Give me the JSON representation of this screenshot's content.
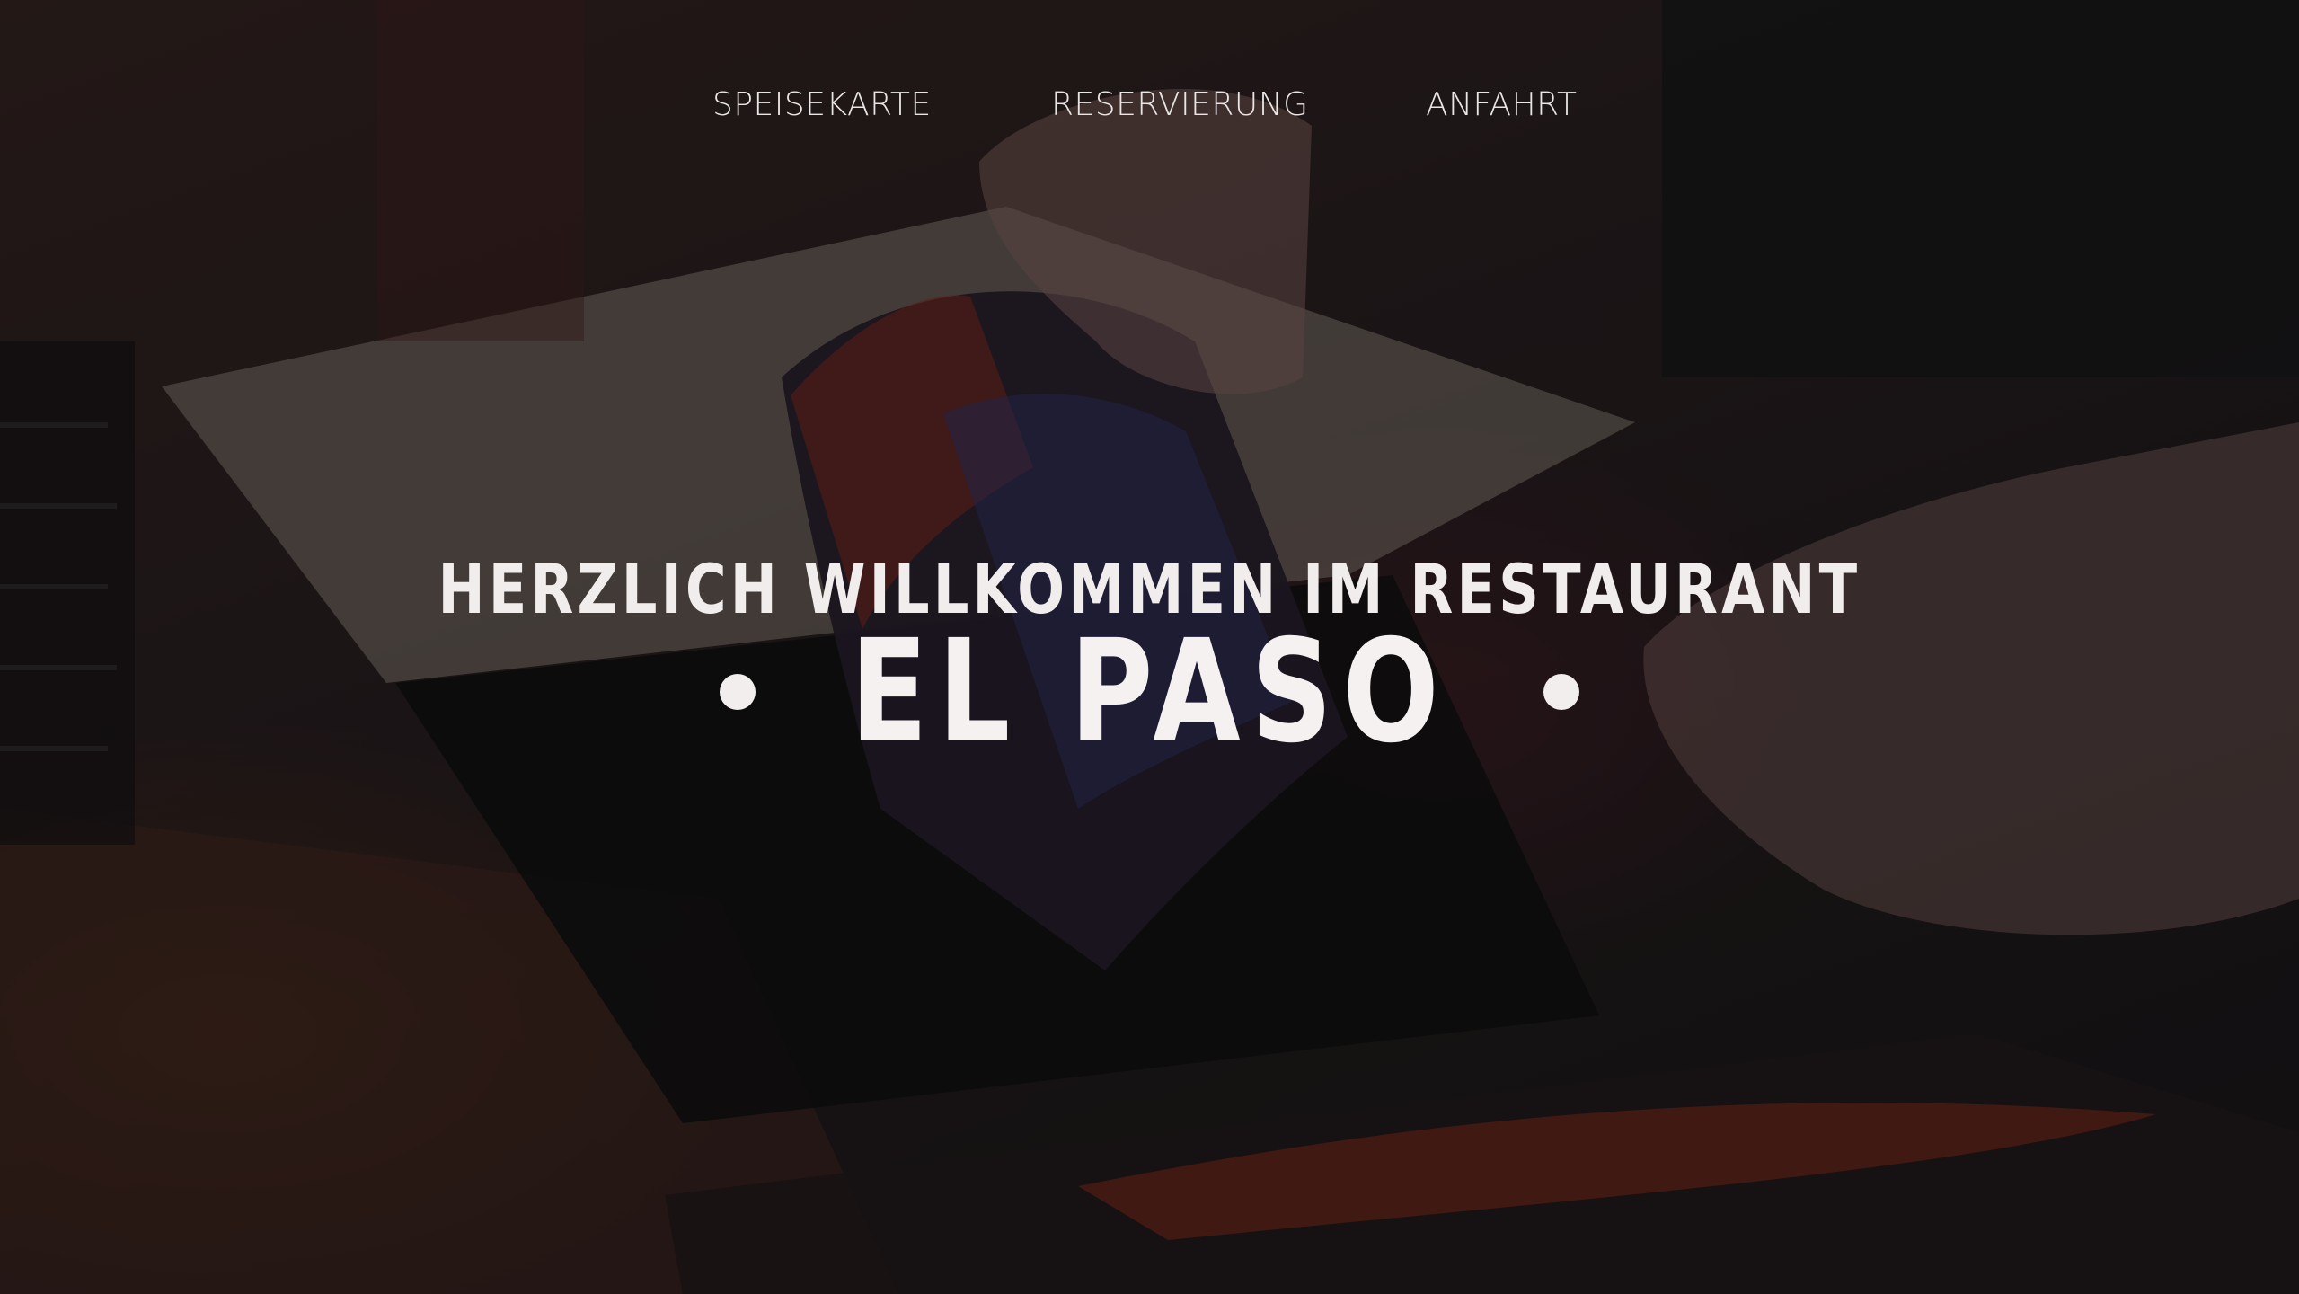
{
  "nav": {
    "items": [
      {
        "label": "SPEISEKARTE"
      },
      {
        "label": "RESERVIERUNG"
      },
      {
        "label": "ANFAHRT"
      }
    ]
  },
  "hero": {
    "headline": "HERZLICH WILLKOMMEN IM RESTAURANT",
    "title": "EL PASO",
    "background_description_icon": "menu-photo-background"
  },
  "colors": {
    "text": "#f2eded",
    "overlay": "#1a1516"
  }
}
